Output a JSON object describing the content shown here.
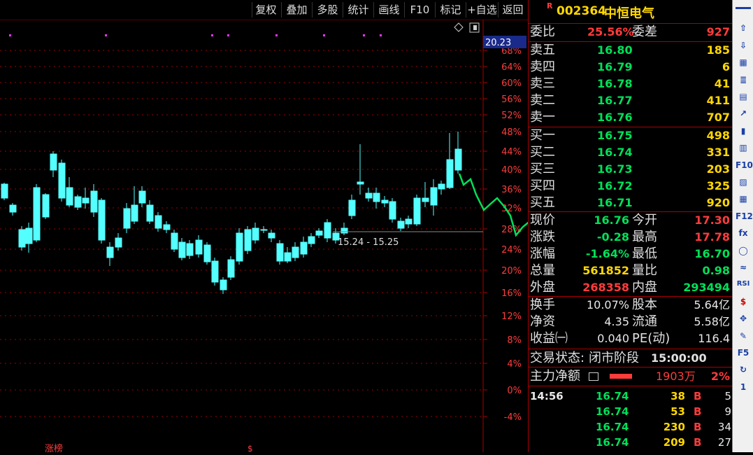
{
  "toolbar": {
    "buttons": [
      "复权",
      "叠加",
      "多股",
      "统计",
      "画线",
      "F10",
      "标记",
      "+自选",
      "返回"
    ]
  },
  "chart": {
    "current_price_tag": "20.23",
    "y_axis_labels": [
      "68%",
      "64%",
      "60%",
      "56%",
      "52%",
      "48%",
      "44%",
      "40%",
      "36%",
      "32%",
      "28%",
      "24%",
      "20%",
      "16%",
      "12%",
      "8%",
      "4%",
      "0%",
      "-4%"
    ],
    "annotation": "15.24 - 15.25",
    "bottom_label": "涨榜",
    "bottom_marker": "$",
    "colors": {
      "up": "#ff3c3c",
      "down": "#54ffff",
      "line": "#00e05a",
      "grid": "#a00000"
    }
  },
  "quote": {
    "badge": "R",
    "code": "002364",
    "name": "中恒电气",
    "weibi_label": "委比",
    "weibi_value": "25.56%",
    "weicha_label": "委差",
    "weicha_value": "927",
    "asks": [
      {
        "label": "卖五",
        "price": "16.80",
        "vol": "185"
      },
      {
        "label": "卖四",
        "price": "16.79",
        "vol": "6"
      },
      {
        "label": "卖三",
        "price": "16.78",
        "vol": "41"
      },
      {
        "label": "卖二",
        "price": "16.77",
        "vol": "411"
      },
      {
        "label": "卖一",
        "price": "16.76",
        "vol": "707"
      }
    ],
    "bids": [
      {
        "label": "买一",
        "price": "16.75",
        "vol": "498"
      },
      {
        "label": "买二",
        "price": "16.74",
        "vol": "331"
      },
      {
        "label": "买三",
        "price": "16.73",
        "vol": "203"
      },
      {
        "label": "买四",
        "price": "16.72",
        "vol": "325"
      },
      {
        "label": "买五",
        "price": "16.71",
        "vol": "920"
      }
    ],
    "stats": [
      {
        "l1": "现价",
        "v1": "16.76",
        "c1": "green",
        "l2": "今开",
        "v2": "17.30",
        "c2": "red"
      },
      {
        "l1": "涨跌",
        "v1": "-0.28",
        "c1": "green",
        "l2": "最高",
        "v2": "17.78",
        "c2": "red"
      },
      {
        "l1": "涨幅",
        "v1": "-1.64%",
        "c1": "green",
        "l2": "最低",
        "v2": "16.70",
        "c2": "green"
      },
      {
        "l1": "总量",
        "v1": "561852",
        "c1": "yellow",
        "l2": "量比",
        "v2": "0.98",
        "c2": "green"
      },
      {
        "l1": "外盘",
        "v1": "268358",
        "c1": "red",
        "l2": "内盘",
        "v2": "293494",
        "c2": "green"
      }
    ],
    "stats2": [
      {
        "l1": "换手",
        "v1": "10.07%",
        "l2": "股本",
        "v2": "5.64亿"
      },
      {
        "l1": "净资",
        "v1": "4.35",
        "l2": "流通",
        "v2": "5.58亿"
      },
      {
        "l1": "收益㈠",
        "v1": "0.040",
        "l2": "PE(动)",
        "v2": "116.4"
      }
    ],
    "status_label": "交易状态:",
    "status_value": "闭市阶段",
    "status_time": "15:00:00",
    "main_force_label": "主力净额",
    "main_force_value": "1903万",
    "main_force_pct": "2%",
    "ticks": [
      {
        "time": "14:56",
        "price": "16.74",
        "vol": "38",
        "side": "B",
        "n": "5"
      },
      {
        "time": "",
        "price": "16.74",
        "vol": "53",
        "side": "B",
        "n": "9"
      },
      {
        "time": "",
        "price": "16.74",
        "vol": "230",
        "side": "B",
        "n": "34"
      },
      {
        "time": "",
        "price": "16.74",
        "vol": "209",
        "side": "B",
        "n": "27"
      }
    ]
  },
  "sidebar": {
    "icons": [
      "arrow-up-icon",
      "arrow-up-outline-icon",
      "arrow-down-outline-icon",
      "grid-icon",
      "list-icon",
      "table-icon",
      "line-chart-icon",
      "candle-icon",
      "report-icon",
      "f10-icon",
      "notes-icon",
      "document-icon",
      "f12-icon",
      "fx-icon",
      "circle-icon",
      "wave-icon",
      "rsi-icon",
      "dollar-icon",
      "move-icon",
      "pencil-icon",
      "f5-icon",
      "refresh-icon",
      "one-icon"
    ],
    "labels": [
      "",
      "⇧",
      "⇩",
      "▦",
      "≣",
      "▤",
      "↗",
      "▮",
      "▥",
      "F10",
      "▨",
      "▦",
      "F12",
      "fx",
      "◯",
      "≈",
      "RSI",
      "$",
      "✥",
      "✎",
      "F5",
      "↻",
      "1"
    ]
  }
}
